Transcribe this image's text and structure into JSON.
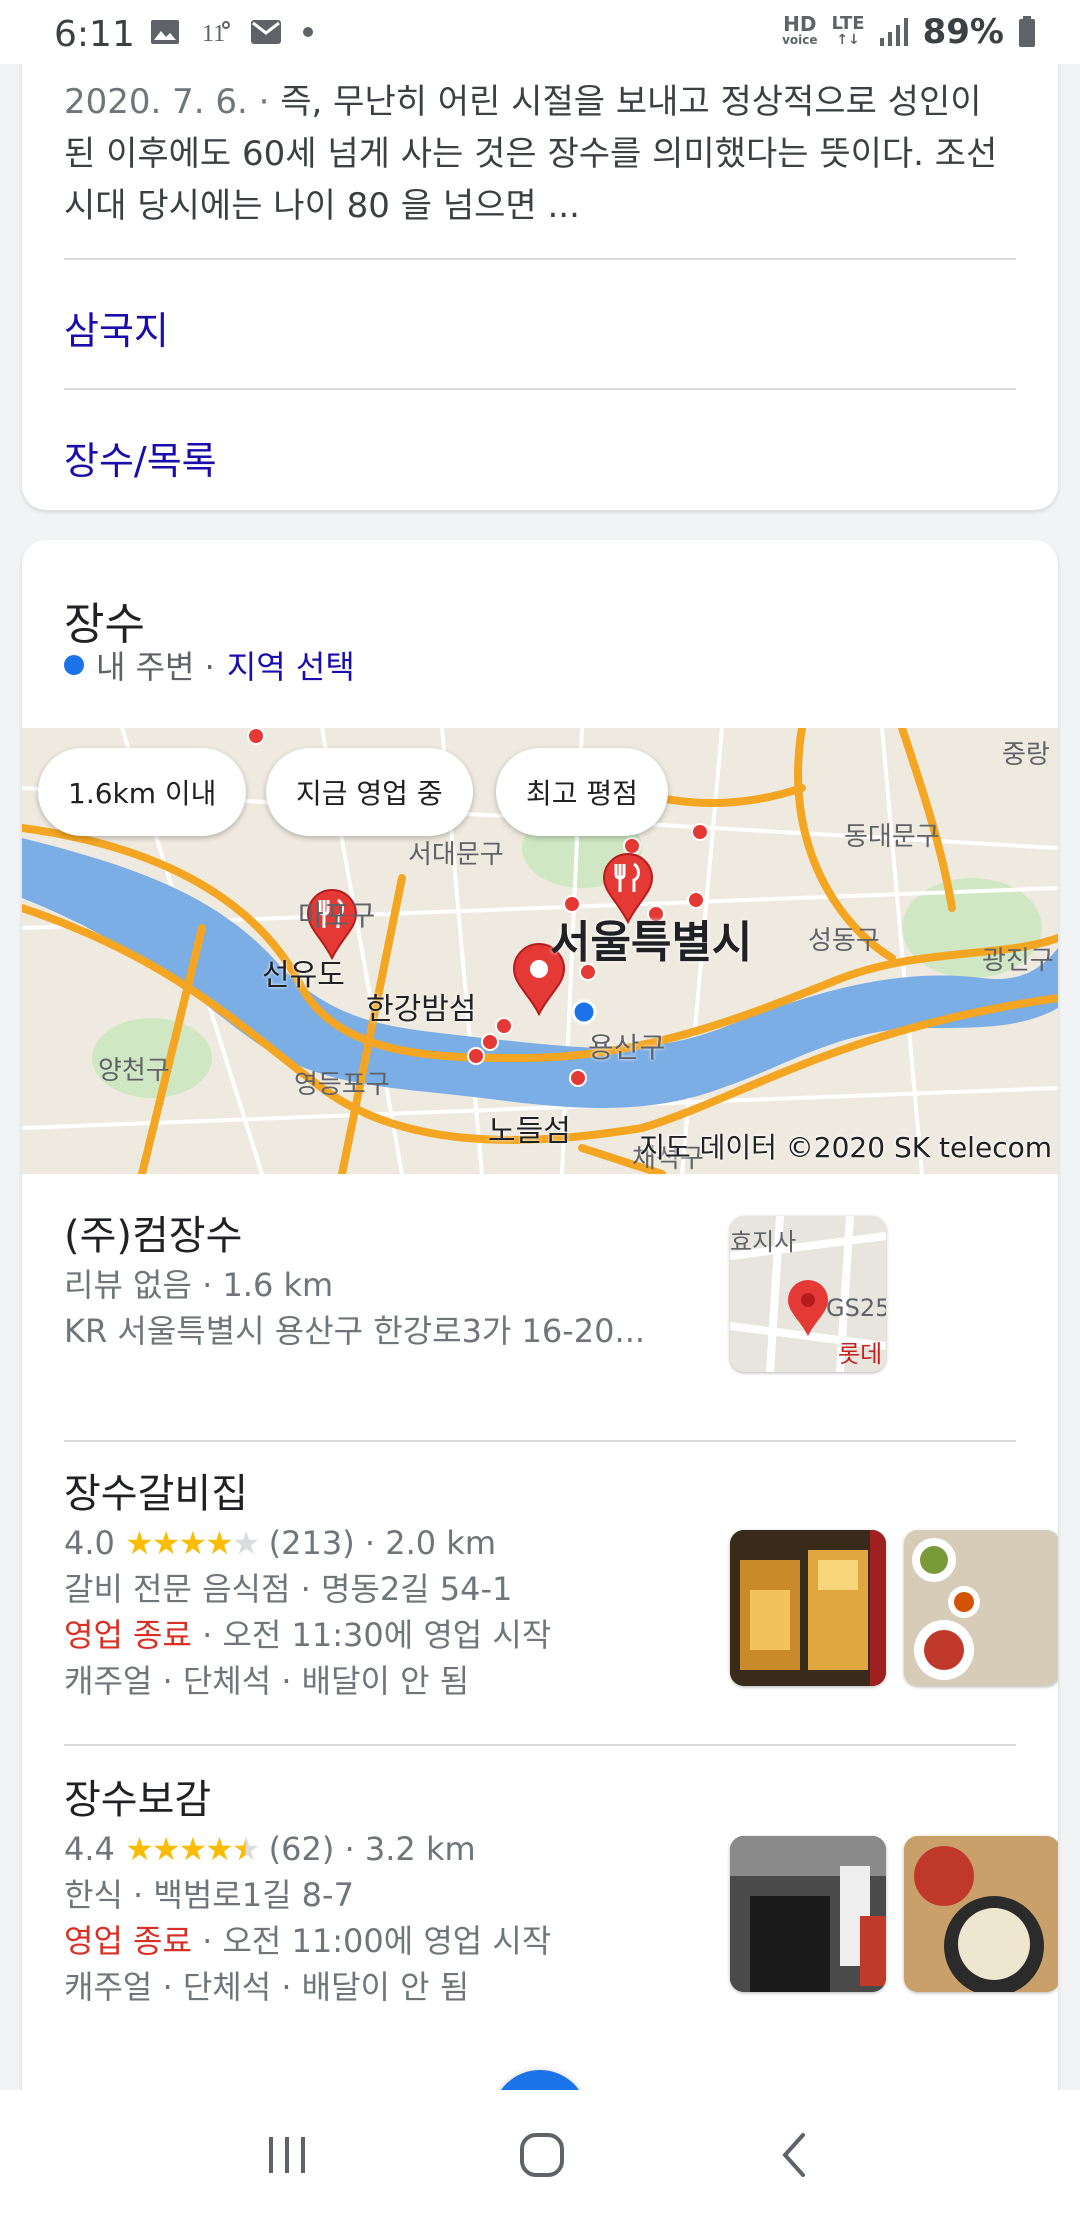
{
  "status_bar": {
    "time": "6:11",
    "network": "LTE",
    "hd": "HD",
    "voice": "voice",
    "battery": "89%"
  },
  "top_card": {
    "snippet_date": "2020. 7. 6. ·",
    "snippet_text": "즉, 무난히 어린 시절을 보내고 정상적으로 성인이 된 이후에도 60세 넘게 사는 것은 장수를 의미했다는 뜻이다. 조선시대 당시에는 나이 80 을 넘으면 ...",
    "links": [
      "삼국지",
      "장수/목록"
    ]
  },
  "local_card": {
    "title": "장수",
    "location_label": "내 주변 ·",
    "location_action": "지역 선택",
    "filters": [
      "1.6km 이내",
      "지금 영업 중",
      "최고 평점"
    ],
    "map_labels": [
      "중랑",
      "동대문구",
      "서대문구",
      "마포구",
      "서울특별시",
      "성동구",
      "광진구",
      "선유도",
      "한강밤섬",
      "용산구",
      "양천구",
      "영등포구",
      "노들섬",
      "채석구"
    ],
    "map_credit": "지도 데이터 ©2020 SK telecom",
    "results": [
      {
        "name": "(주)컴장수",
        "line1": "리뷰 없음 · 1.6 km",
        "line2": "KR 서울특별시 용산구 한강로3가 16-20...",
        "thumb_labels": [
          "효지사",
          "GS25",
          "롯데리"
        ]
      },
      {
        "name": "장수갈비집",
        "rating": "4.0",
        "stars": 4.0,
        "reviews": "(213) · 2.0 km",
        "line2": "갈비 전문 음식점 · 명동2길 54-1",
        "status": "영업 종료",
        "hours": " · 오전 11:30에 영업 시작",
        "line4": "캐주얼 · 단체석 · 배달이 안 됨"
      },
      {
        "name": "장수보감",
        "rating": "4.4",
        "stars": 4.5,
        "reviews": "(62) · 3.2 km",
        "line2": "한식 · 백범로1길 8-7",
        "status": "영업 종료",
        "hours": " · 오전 11:00에 영업 시작",
        "line4": "캐주얼 · 단체석 · 배달이 안 됨"
      }
    ]
  },
  "colors": {
    "link": "#1a0dab",
    "closed": "#d93025",
    "star": "#fbbc04",
    "map_water": "#7baee5",
    "map_road": "#f4a623",
    "pin": "#e53935"
  }
}
